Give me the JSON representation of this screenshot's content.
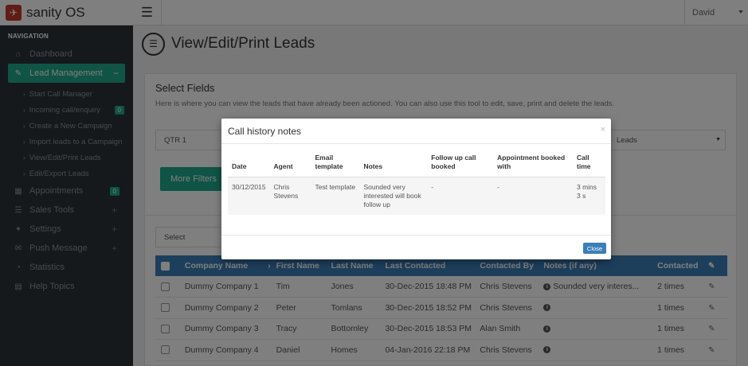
{
  "app": {
    "name": "sanity OS"
  },
  "topbar": {
    "user": "David"
  },
  "sidebar": {
    "header": "NAVIGATION",
    "items": [
      {
        "label": "Dashboard",
        "icon": "home-icon"
      },
      {
        "label": "Lead Management",
        "icon": "edit-icon",
        "active": true,
        "sub": [
          {
            "label": "Start Call Manager"
          },
          {
            "label": "Incoming call/enquiry",
            "badge": "0"
          },
          {
            "label": "Create a New Campaign"
          },
          {
            "label": "Import leads to a Campaign"
          },
          {
            "label": "View/Edit/Print Leads"
          },
          {
            "label": "Edit/Export Leads"
          }
        ]
      },
      {
        "label": "Appointments",
        "icon": "calendar-icon",
        "badge": "0"
      },
      {
        "label": "Sales Tools",
        "icon": "list-icon",
        "plus": "+"
      },
      {
        "label": "Settings",
        "icon": "wrench-icon",
        "plus": "+"
      },
      {
        "label": "Push Message",
        "icon": "envelope-icon",
        "plus": "+"
      },
      {
        "label": "Statistics",
        "icon": "dashboard-icon"
      },
      {
        "label": "Help Topics",
        "icon": "book-icon"
      }
    ]
  },
  "page": {
    "title": "View/Edit/Print Leads"
  },
  "select_fields": {
    "title": "Select Fields",
    "description": "Here is where you can view the leads that have already been actioned. You can also use this tool to edit, save, print and delete the leads.",
    "campaign_value": "QTR 1",
    "type_value": "Leads",
    "more_filters": "More Filters"
  },
  "leads_table": {
    "bulk_select": "Select",
    "columns": [
      "Company Name",
      "First Name",
      "Last Name",
      "Last Contacted",
      "Contacted By",
      "Notes (if any)",
      "Contacted"
    ],
    "rows": [
      {
        "company": "Dummy Company 1",
        "first": "Tim",
        "last": "Jones",
        "last_contacted": "30-Dec-2015 18:48 PM",
        "by": "Chris Stevens",
        "notes": "Sounded very interes...",
        "contacted": "2 times"
      },
      {
        "company": "Dummy Company 2",
        "first": "Peter",
        "last": "Tomlans",
        "last_contacted": "30-Dec-2015 18:52 PM",
        "by": "Chris Stevens",
        "notes": "",
        "contacted": "1 times"
      },
      {
        "company": "Dummy Company 3",
        "first": "Tracy",
        "last": "Bottomley",
        "last_contacted": "30-Dec-2015 18:53 PM",
        "by": "Alan Smith",
        "notes": "",
        "contacted": "1 times"
      },
      {
        "company": "Dummy Company 4",
        "first": "Daniel",
        "last": "Homes",
        "last_contacted": "04-Jan-2016 22:18 PM",
        "by": "Chris Stevens",
        "notes": "",
        "contacted": "1 times"
      }
    ]
  },
  "modal": {
    "title": "Call history notes",
    "close_symbol": "×",
    "columns": [
      "Date",
      "Agent",
      "Email template",
      "Notes",
      "Follow up call booked",
      "Appointment booked with",
      "Call time"
    ],
    "rows": [
      {
        "date": "30/12/2015",
        "agent": "Chris Stevens",
        "template": "Test template",
        "notes": "Sounded very interested will book follow up",
        "follow_up": "-",
        "appointment": "-",
        "call_time": "3 mins 3 s"
      }
    ],
    "close_button": "Close"
  }
}
